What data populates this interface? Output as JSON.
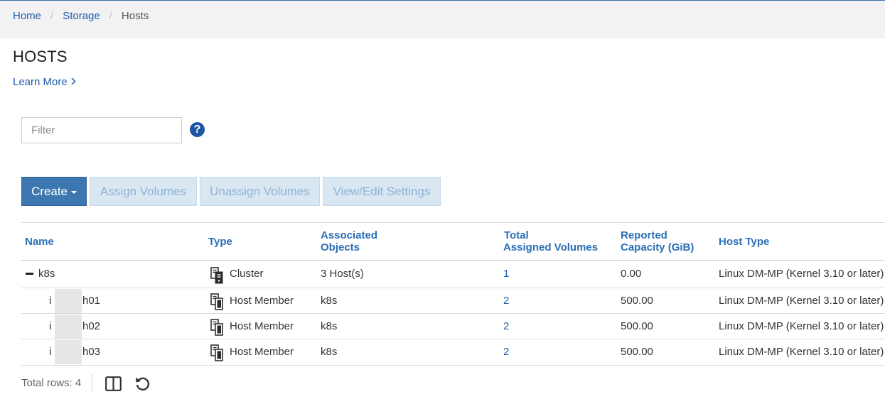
{
  "breadcrumb": {
    "items": [
      {
        "label": "Home"
      },
      {
        "label": "Storage"
      },
      {
        "label": "Hosts"
      }
    ],
    "separator": "/"
  },
  "page": {
    "title": "HOSTS",
    "learn_more": "Learn More",
    "learn_more_icon": "chevron-right-icon"
  },
  "filter": {
    "value": "",
    "placeholder": "Filter",
    "help_icon": "question-circle-icon"
  },
  "toolbar": {
    "create_label": "Create",
    "assign_label": "Assign Volumes",
    "unassign_label": "Unassign Volumes",
    "viewedit_label": "View/Edit Settings"
  },
  "table": {
    "headers": {
      "name": "Name",
      "type": "Type",
      "associated_1": "Associated",
      "associated_2": "Objects",
      "total_1": "Total",
      "total_2": "Assigned Volumes",
      "reported_1": "Reported",
      "reported_2": "Capacity (GiB)",
      "host_type": "Host Type"
    },
    "rows": [
      {
        "name": "k8s",
        "type": "Cluster",
        "associated": "3 Host(s)",
        "volumes": "1",
        "capacity": "0.00",
        "host_type": "Linux DM-MP (Kernel 3.10 or later)"
      },
      {
        "name_prefix": "i",
        "name_suffix": "h01",
        "type": "Host Member",
        "associated": "k8s",
        "volumes": "2",
        "capacity": "500.00",
        "host_type": "Linux DM-MP (Kernel 3.10 or later)"
      },
      {
        "name_prefix": "i",
        "name_suffix": "h02",
        "type": "Host Member",
        "associated": "k8s",
        "volumes": "2",
        "capacity": "500.00",
        "host_type": "Linux DM-MP (Kernel 3.10 or later)"
      },
      {
        "name_prefix": "i",
        "name_suffix": "h03",
        "type": "Host Member",
        "associated": "k8s",
        "volumes": "2",
        "capacity": "500.00",
        "host_type": "Linux DM-MP (Kernel 3.10 or later)"
      }
    ]
  },
  "footer": {
    "total_rows": "Total rows: 4",
    "columns_icon": "columns-icon",
    "refresh_icon": "refresh-icon"
  },
  "colors": {
    "link": "#1f5ca8",
    "header_text": "#2a6fb5",
    "primary_button": "#3d77b0",
    "disabled_button": "#d9e7f3"
  }
}
